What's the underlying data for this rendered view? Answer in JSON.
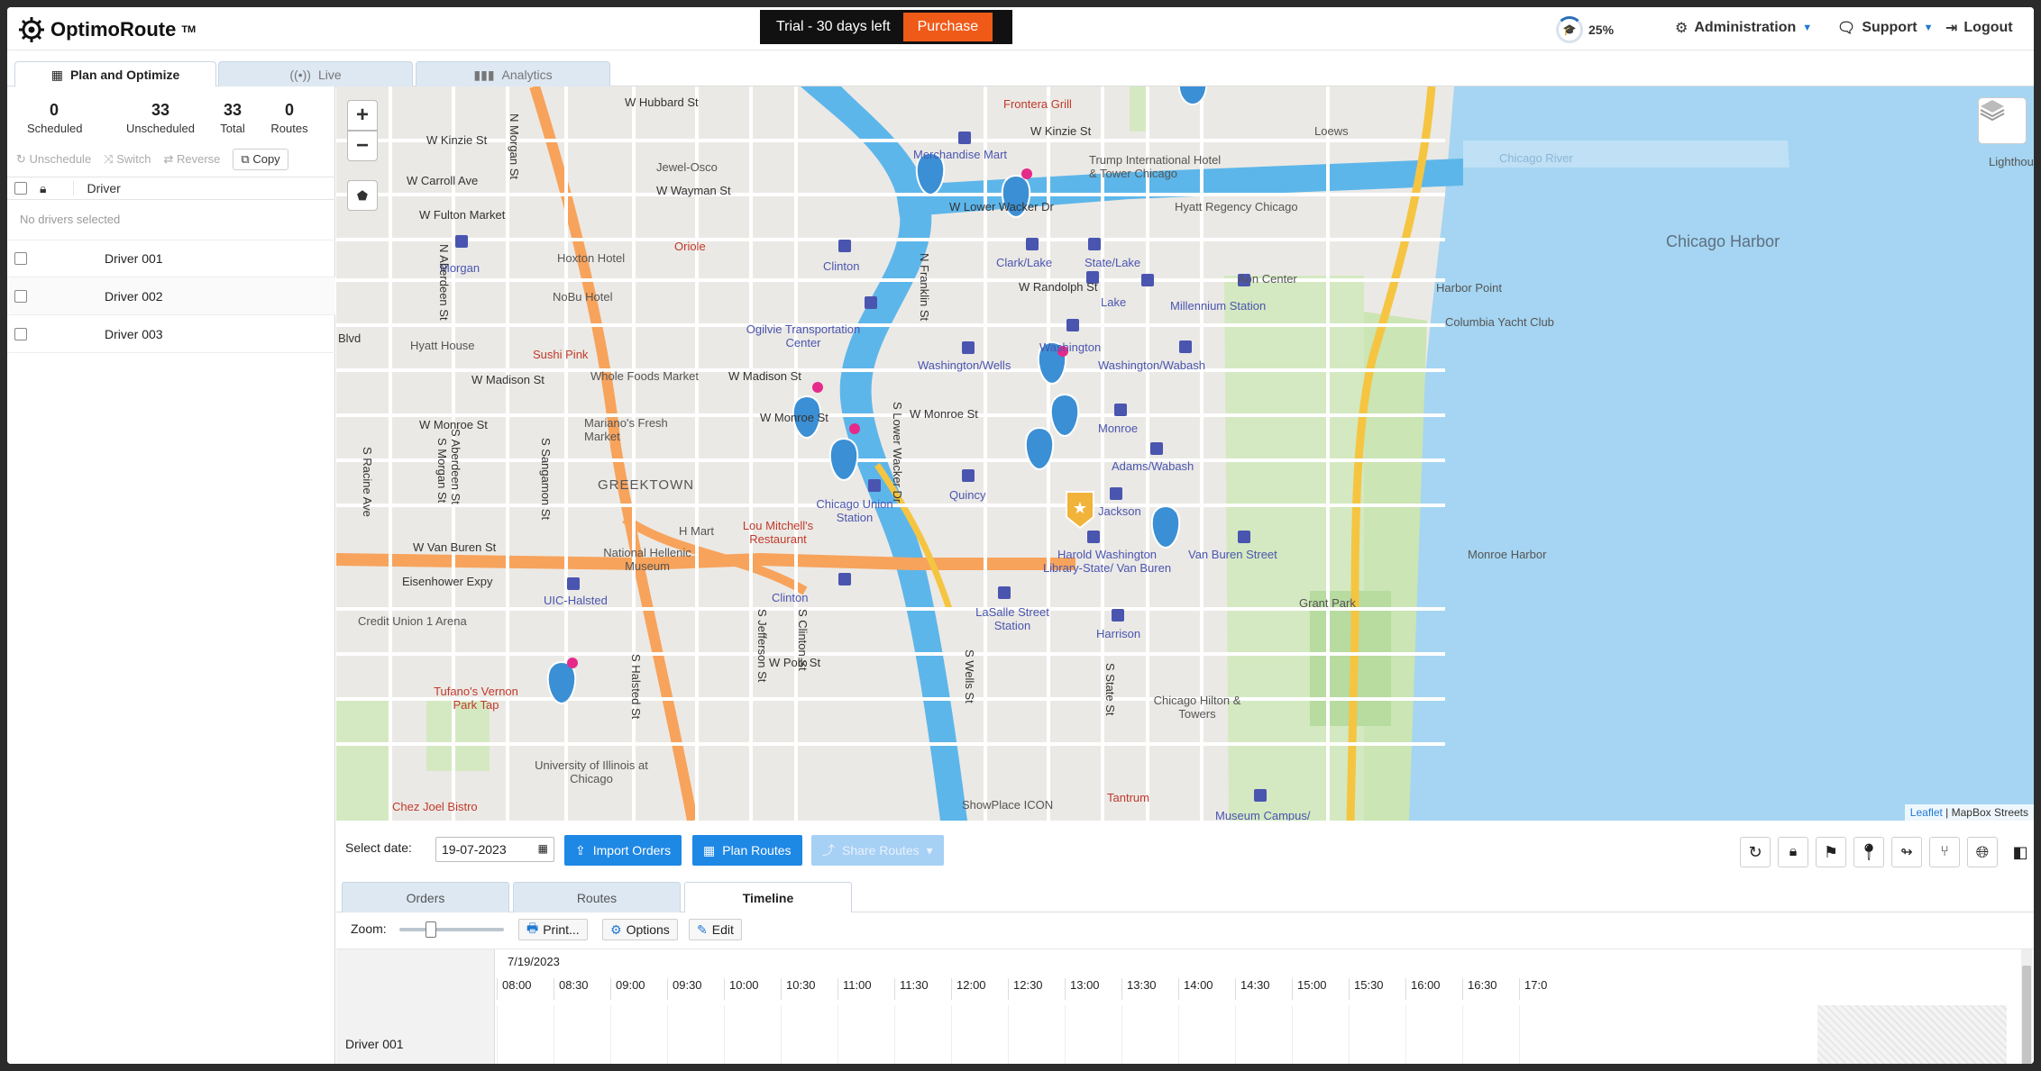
{
  "header": {
    "logo": "OptimoRoute",
    "logo_tm": "TM",
    "trial_text": "Trial - 30 days left",
    "purchase_label": "Purchase",
    "progress": "25%",
    "administration": "Administration",
    "support": "Support",
    "logout": "Logout"
  },
  "tabs": [
    {
      "label": "Plan and Optimize"
    },
    {
      "label": "Live"
    },
    {
      "label": "Analytics"
    }
  ],
  "stats": [
    {
      "value": "0",
      "label": "Scheduled"
    },
    {
      "value": "33",
      "label": "Unscheduled"
    },
    {
      "value": "33",
      "label": "Total"
    },
    {
      "value": "0",
      "label": "Routes"
    }
  ],
  "side_actions": {
    "unschedule": "Unschedule",
    "switch": "Switch",
    "reverse": "Reverse",
    "copy": "Copy"
  },
  "driver_header": "Driver",
  "no_drivers": "No drivers selected",
  "drivers": [
    "Driver 001",
    "Driver 002",
    "Driver 003"
  ],
  "map": {
    "attribution_leaflet": "Leaflet",
    "attribution_rest": "| MapBox Streets",
    "labels": [
      "W Hubbard St",
      "W Kinzie St",
      "W Carroll Ave",
      "W Fulton Market",
      "Jewel-Osco",
      "W Wayman St",
      "Merchandise Mart",
      "W Kinzie St",
      "Frontera Grill",
      "Trump International Hotel & Tower Chicago",
      "Loews",
      "Chicago River",
      "W Lower Wacker Dr",
      "Hyatt Regency Chicago",
      "Chicago Harbor",
      "Morgan",
      "Hoxton Hotel",
      "Oriole",
      "Clinton",
      "Clark/Lake",
      "State/Lake",
      "Aon Center",
      "Harbor Point",
      "NoBu Hotel",
      "W Randolph St",
      "Lake",
      "Millennium Station",
      "Columbia Yacht Club",
      "Hyatt House",
      "Ogilvie Transportation Center",
      "Washington",
      "Sushi Pink",
      "Washington/Wells",
      "Washington/Wabash",
      "W Madison St",
      "Whole Foods Market",
      "W Madison St",
      "W Monroe St",
      "Mariano's Fresh Market",
      "W Monroe St",
      "W Monroe St",
      "Monroe",
      "Adams/Wabash",
      "GREEKTOWN",
      "Chicago Union Station",
      "Quincy",
      "Jackson",
      "Lou Mitchell's Restaurant",
      "H Mart",
      "W Van Buren St",
      "National Hellenic Museum",
      "Harold Washington Library-State/ Van Buren",
      "Van Buren Street",
      "Monroe Harbor",
      "Eisenhower Expy",
      "UIC-Halsted",
      "Clinton",
      "LaSalle Street Station",
      "Grant Park",
      "Credit Union 1 Arena",
      "Harrison",
      "Tufano's Vernon Park Tap",
      "W Polk St",
      "Chicago Hilton & Towers",
      "University of Illinois at Chicago",
      "ShowPlace ICON",
      "Tantrum",
      "Chez Joel Bistro",
      "Museum Campus/",
      "Lighthouse",
      "Blvd",
      "S Racine Ave",
      "S Morgan St",
      "S Aberdeen St",
      "S Sangamon St",
      "S Halsted St",
      "S Jefferson St",
      "S Clinton St",
      "S Wells St",
      "S State St",
      "N Franklin St",
      "S Lower Wacker Dr",
      "N Morgan St",
      "N Aberdeen St"
    ]
  },
  "toolbar": {
    "select_date_label": "Select date:",
    "date_value": "19-07-2023",
    "import_orders": "Import Orders",
    "plan_routes": "Plan Routes",
    "share_routes": "Share Routes"
  },
  "bottom_tabs": [
    {
      "label": "Orders"
    },
    {
      "label": "Routes"
    },
    {
      "label": "Timeline"
    }
  ],
  "timeline": {
    "zoom_label": "Zoom:",
    "print": "Print...",
    "options": "Options",
    "edit": "Edit",
    "date": "7/19/2023",
    "zoom_level": 0.28,
    "hours": [
      "08:00",
      "08:30",
      "09:00",
      "09:30",
      "10:00",
      "10:30",
      "11:00",
      "11:30",
      "12:00",
      "12:30",
      "13:00",
      "13:30",
      "14:00",
      "14:30",
      "15:00",
      "15:30",
      "16:00",
      "16:30",
      "17:0"
    ],
    "driver": "Driver 001"
  },
  "colors": {
    "accent": "#1e88e5",
    "purchase": "#f05a18",
    "water": "#a5d5f2",
    "park": "#d4e9c1",
    "highway": "#f7a35c",
    "pin": "#3b8fd4"
  }
}
